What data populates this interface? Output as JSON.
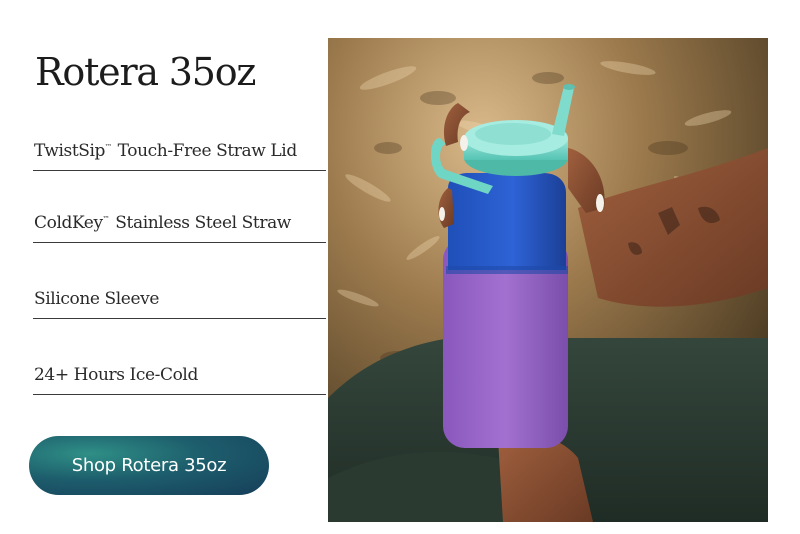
{
  "product": {
    "title": "Rotera 35oz"
  },
  "features": [
    {
      "name": "TwistSip",
      "mark": "™",
      "rest": " Touch-Free Straw Lid"
    },
    {
      "name": "ColdKey",
      "mark": "™",
      "rest": " Stainless Steel Straw"
    },
    {
      "name": "Silicone Sleeve",
      "mark": "",
      "rest": ""
    },
    {
      "name": "24+ Hours Ice-Cold",
      "mark": "",
      "rest": ""
    }
  ],
  "cta": {
    "label": "Shop Rotera 35oz"
  },
  "colors": {
    "cta_gradient_start": "#2f8f86",
    "cta_gradient_end": "#163e59",
    "bottle_body": "#2657c4",
    "bottle_sleeve": "#9a66c8",
    "bottle_lid": "#6fd6c6"
  },
  "photo": {
    "subject": "bottle-in-hands-image"
  }
}
